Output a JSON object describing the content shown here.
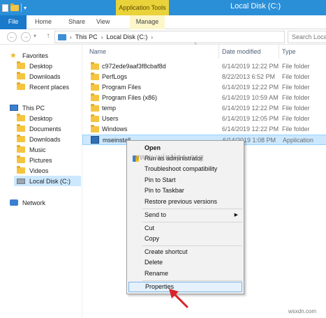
{
  "window": {
    "title": "Local Disk (C:)",
    "context_tab": "Application Tools",
    "accent": "#2b8fd8"
  },
  "ribbon": {
    "tabs": [
      "File",
      "Home",
      "Share",
      "View",
      "Manage"
    ]
  },
  "address": {
    "crumbs": [
      "This PC",
      "Local Disk (C:)"
    ],
    "search_placeholder": "Search Local"
  },
  "nav": {
    "favorites": "Favorites",
    "fav_items": [
      "Desktop",
      "Downloads",
      "Recent places"
    ],
    "this_pc": "This PC",
    "pc_items": [
      "Desktop",
      "Documents",
      "Downloads",
      "Music",
      "Pictures",
      "Videos",
      "Local Disk (C:)"
    ],
    "network": "Network"
  },
  "columns": {
    "name": "Name",
    "date": "Date modified",
    "type": "Type"
  },
  "files": [
    {
      "name": "c972ede9aaf3f8cbaf8d",
      "date": "6/14/2019 12:22 PM",
      "type": "File folder"
    },
    {
      "name": "PerfLogs",
      "date": "8/22/2013 6:52 PM",
      "type": "File folder"
    },
    {
      "name": "Program Files",
      "date": "6/14/2019 12:22 PM",
      "type": "File folder"
    },
    {
      "name": "Program Files (x86)",
      "date": "6/14/2019 10:59 AM",
      "type": "File folder"
    },
    {
      "name": "temp",
      "date": "6/14/2019 12:22 PM",
      "type": "File folder"
    },
    {
      "name": "Users",
      "date": "6/14/2019 12:05 PM",
      "type": "File folder"
    },
    {
      "name": "Windows",
      "date": "6/14/2019 12:22 PM",
      "type": "File folder"
    },
    {
      "name": "mseinstall",
      "date": "6/14/2019 1:08 PM",
      "type": "Application"
    }
  ],
  "context_menu": {
    "open": "Open",
    "run_as_admin": "Run as administrator",
    "troubleshoot": "Troubleshoot compatibility",
    "pin_start": "Pin to Start",
    "pin_taskbar": "Pin to Taskbar",
    "restore": "Restore previous versions",
    "send_to": "Send to",
    "cut": "Cut",
    "copy": "Copy",
    "create_shortcut": "Create shortcut",
    "delete": "Delete",
    "rename": "Rename",
    "properties": "Properties"
  },
  "watermark": "www.wintips.org",
  "site_mark": "wsxdn.com",
  "colors": {
    "arrow": "#d8232a",
    "selection": "#cce8ff",
    "file_tab": "#1979ca",
    "tools_tab": "#e9d23a"
  }
}
